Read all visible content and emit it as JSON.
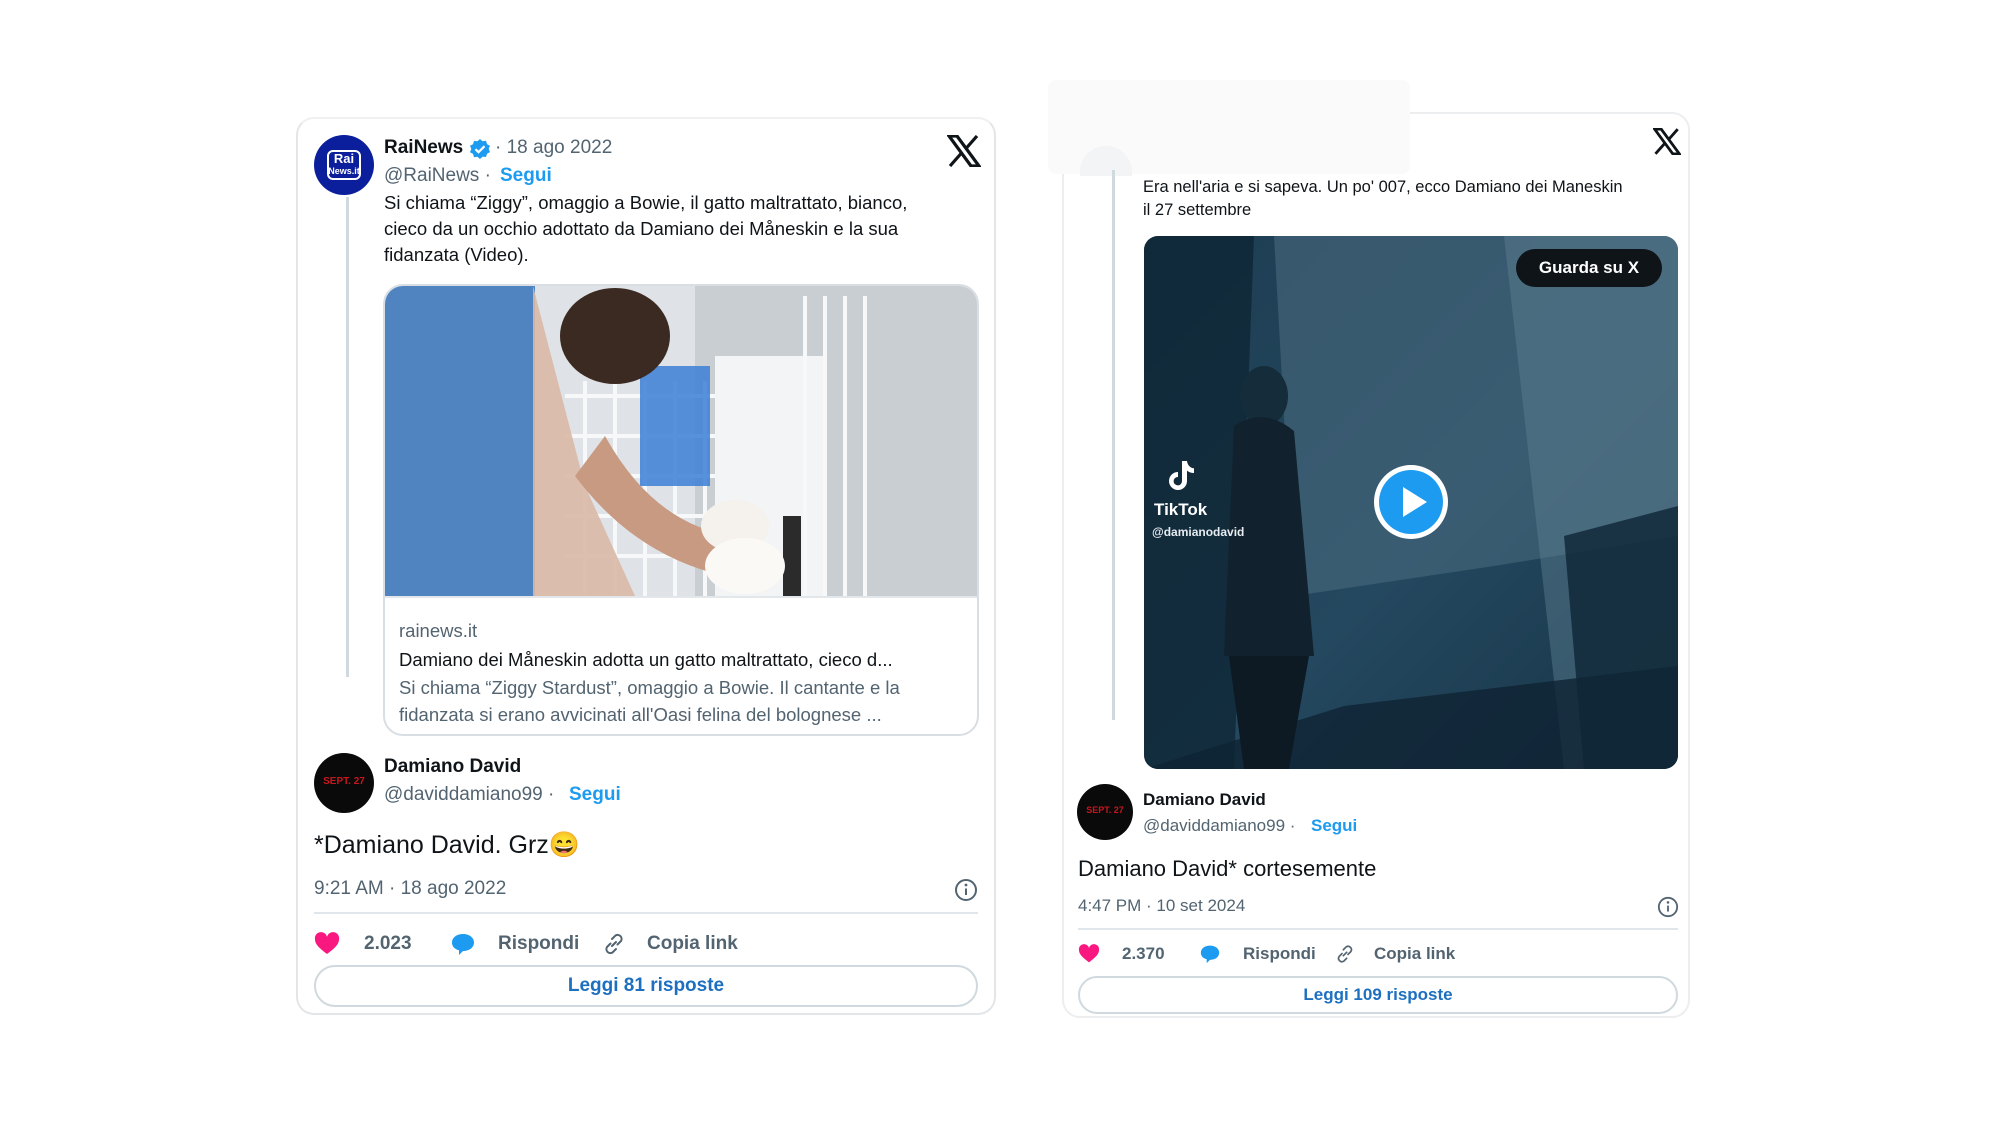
{
  "tweet1": {
    "quoted": {
      "avatar_text": [
        "Rai",
        "News.it"
      ],
      "author_name": "RaiNews",
      "date": "· 18 ago 2022",
      "handle": "@RaiNews ·",
      "follow": "Segui",
      "text": [
        "Si chiama “Ziggy”, omaggio a Bowie, il gatto maltrattato, bianco,",
        "cieco da un occhio adottato da Damiano dei Måneskin e la sua",
        "fidanzata (Video)."
      ],
      "link_domain": "rainews.it",
      "link_title": "Damiano dei Måneskin adotta un gatto maltrattato, cieco d...",
      "link_desc": [
        "Si chiama “Ziggy Stardust”, omaggio a Bowie. Il cantante e la",
        "fidanzata si erano avvicinati all'Oasi felina del bolognese ..."
      ]
    },
    "author_name": "Damiano David",
    "avatar_text": "SEPT. 27",
    "handle": "@daviddamiano99 ·",
    "follow": "Segui",
    "text": "*Damiano David. Grz😄",
    "timestamp": "9:21 AM · 18 ago 2022",
    "likes": "2.023",
    "reply_label": "Rispondi",
    "copy_label": "Copia link",
    "read_replies": "Leggi 81 risposte"
  },
  "tweet2": {
    "quoted_text": [
      "Era nell'aria e si sapeva. Un po' 007, ecco Damiano dei Maneskin",
      "il 27 settembre"
    ],
    "watch_label": "Guarda su X",
    "tiktok_label": "TikTok",
    "tiktok_handle": "@damianodavid",
    "author_name": "Damiano David",
    "avatar_text": "SEPT. 27",
    "handle": "@daviddamiano99 ·",
    "follow": "Segui",
    "text": "Damiano David* cortesemente",
    "timestamp": "4:47 PM · 10 set 2024",
    "likes": "2.370",
    "reply_label": "Rispondi",
    "copy_label": "Copia link",
    "read_replies": "Leggi 109 risposte"
  },
  "colors": {
    "like": "#f91880",
    "verified": "#1d9bf0",
    "link_blue": "#1d9bf0",
    "button_blue": "#1d6fc0"
  }
}
